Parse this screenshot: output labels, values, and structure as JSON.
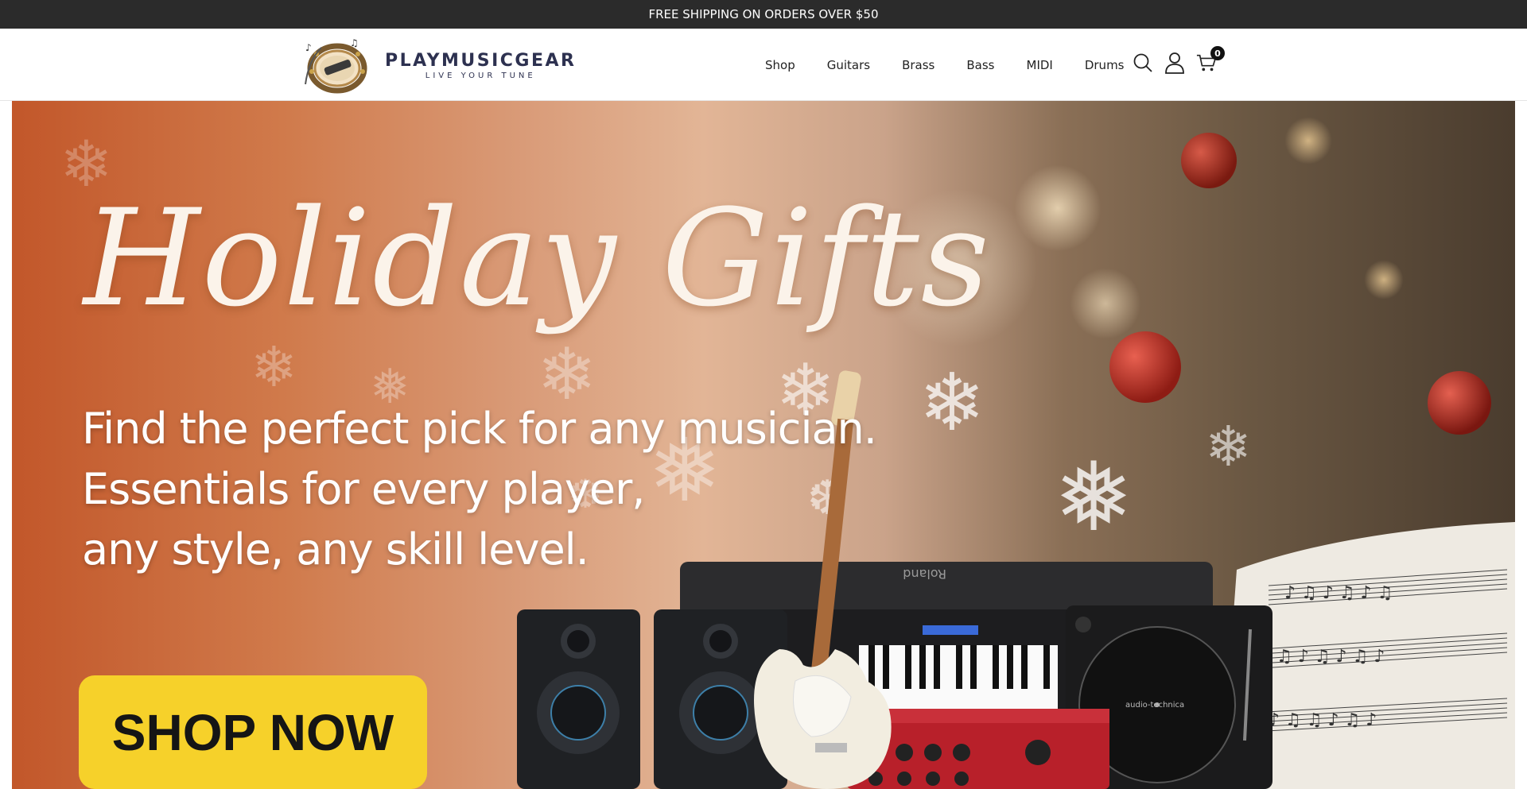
{
  "announcement": "FREE SHIPPING ON ORDERS OVER $50",
  "brand": {
    "name": "PLAYMUSICGEAR",
    "tagline": "LIVE YOUR TUNE"
  },
  "nav": [
    "Shop",
    "Guitars",
    "Brass",
    "Bass",
    "MIDI",
    "Drums"
  ],
  "header_icons": [
    "search-icon",
    "account-icon",
    "cart-icon"
  ],
  "cart": {
    "count": "0"
  },
  "hero": {
    "title": "Holiday Gifts",
    "lines": [
      "Find the perfect pick for any musician.",
      "Essentials for every player,",
      "any style, any skill level."
    ],
    "cta": "SHOP NOW",
    "product_labels": {
      "keyboard": "Roland",
      "turntable": "audio-technica"
    }
  },
  "colors": {
    "announce_bg": "#2b2b2b",
    "cta": "#f6d12a",
    "brand": "#2d3150"
  }
}
